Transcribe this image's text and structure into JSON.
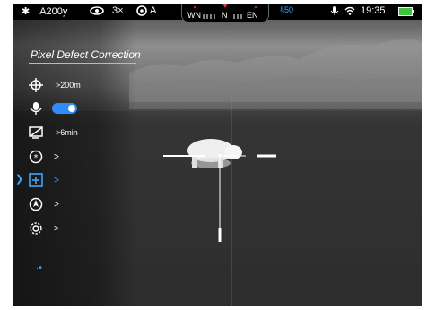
{
  "status_bar": {
    "brightness_icon": "sun-icon",
    "mode_label": "A200y",
    "eye_icon": "eye-icon",
    "zoom": "3×",
    "calibration_icon": "gear-shutter-icon",
    "calibration_mode": "A",
    "recording_icon": "microphone-icon",
    "wifi_icon": "wifi-icon",
    "time": "19:35",
    "battery_icon": "battery-icon",
    "battery_color": "#3cc43c",
    "rec_label": "§50"
  },
  "compass": {
    "left": "WN",
    "center": "N",
    "right": "EN"
  },
  "menu": {
    "title": "Pixel Defect Correction",
    "items": [
      {
        "icon": "crosshair-icon",
        "value": "200m"
      },
      {
        "icon": "microphone-icon",
        "value": ""
      },
      {
        "icon": "display-off-icon",
        "value": "6min"
      },
      {
        "icon": "asterisk-circle-icon",
        "value": ""
      },
      {
        "icon": "pixel-correction-icon",
        "value": ""
      },
      {
        "icon": "compass-icon",
        "value": ""
      },
      {
        "icon": "gear-icon",
        "value": ""
      }
    ],
    "selected_index": 4,
    "page_indicator": "·•"
  },
  "colors": {
    "accent": "#3aa7ff",
    "toggle_on": "#2f8cff"
  }
}
